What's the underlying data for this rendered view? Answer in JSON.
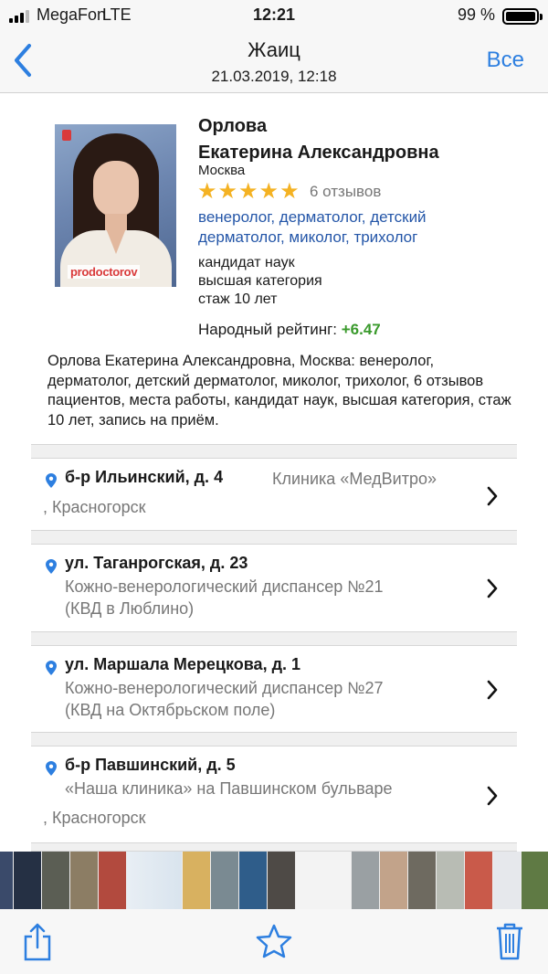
{
  "status_bar": {
    "carrier": "MegaFon",
    "network": "LTE",
    "time": "12:21",
    "battery": "99 %"
  },
  "nav": {
    "title": "Жаиц",
    "subtitle": "21.03.2019, 12:18",
    "all_label": "Все"
  },
  "doctor": {
    "photo_brand": "prodoctorov",
    "surname": "Орлова",
    "given_names": "Екатерина Александровна",
    "city": "Москва",
    "stars": 5,
    "reviews": "6 отзывов",
    "specialties": "венеролог, дерматолог, детский дерматолог, миколог, трихолог",
    "degree": "кандидат наук",
    "category": "высшая категория",
    "experience": "стаж 10 лет",
    "rating_label": "Народный рейтинг:",
    "rating_value": "+6.47",
    "description": "Орлова Екатерина Александровна, Москва: венеролог, дерматолог, детский дерматолог, миколог, трихолог, 6 отзывов пациентов, места работы, кандидат наук, высшая категория, стаж 10 лет, запись на приём."
  },
  "locations": [
    {
      "street": "б-р Ильинский, д. 4",
      "clinic": "Клиника «МедВитро»",
      "extra": ", Красногорск"
    },
    {
      "street": "ул. Таганрогская, д. 23",
      "clinic": "Кожно-венерологический диспансер №21",
      "extra": "(КВД в Люблино)"
    },
    {
      "street": "ул. Маршала Мерецкова, д. 1",
      "clinic": "Кожно-венерологический диспансер №27",
      "extra": "(КВД на Октябрьском поле)"
    },
    {
      "street": "б-р Павшинский, д. 5",
      "clinic": "«Наша клиника» на Павшинском бульваре",
      "extra": ", Красногорск"
    }
  ],
  "colors": {
    "accent": "#2d7fe0",
    "link": "#2456a8",
    "star": "#f4b223",
    "rating_positive": "#3a9a2c"
  },
  "icons": {
    "back": "chevron-left-icon",
    "share": "share-icon",
    "favorite": "star-outline-icon",
    "delete": "trash-icon",
    "location": "map-pin-icon",
    "disclosure": "chevron-right-icon"
  }
}
